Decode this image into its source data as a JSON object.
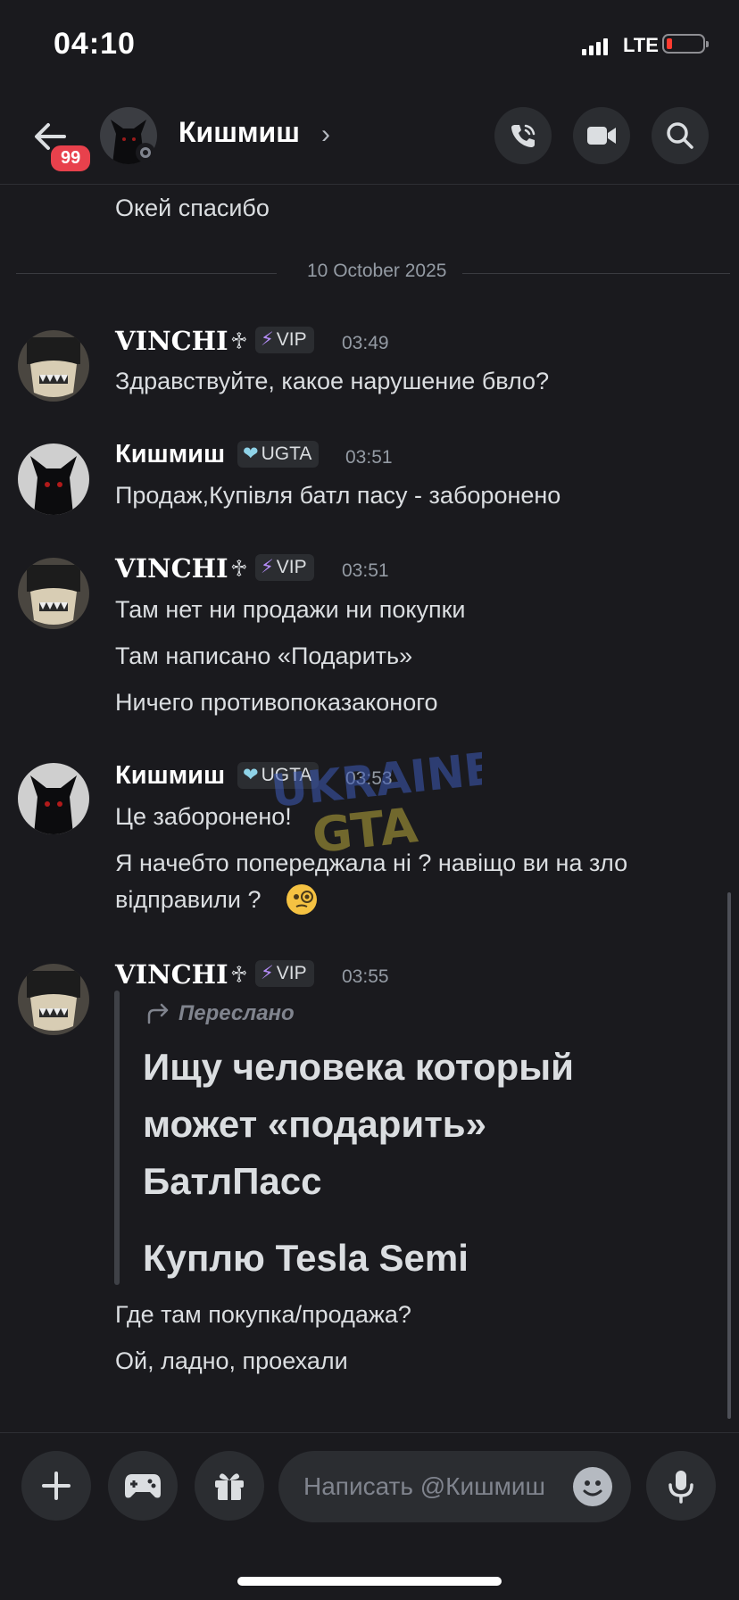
{
  "status_bar": {
    "time": "04:10",
    "network": "LTE"
  },
  "header": {
    "badge": "99",
    "contact_name": "Кишмиш"
  },
  "messages": {
    "prev_text": "Окей спасибо",
    "date_divider": "10 October 2025",
    "m1": {
      "author": "VINCHI",
      "tag": "VIP",
      "time": "03:49",
      "lines": [
        "Здравствуйте, какое нарушение бвло?"
      ]
    },
    "m2": {
      "author": "Кишмиш",
      "tag": "UGTA",
      "time": "03:51",
      "lines": [
        "Продаж,Купівля батл пасу - заборонено"
      ]
    },
    "m3": {
      "author": "VINCHI",
      "tag": "VIP",
      "time": "03:51",
      "lines": [
        "Там нет ни продажи ни покупки",
        "Там написано «Подарить»",
        "Ничего противопоказаконого"
      ]
    },
    "m4": {
      "author": "Кишмиш",
      "tag": "UGTA",
      "time": "03:53",
      "lines": [
        "Це заборонено!",
        "Я начебто попереджала ні ? навіщо ви на зло",
        "відправили ?"
      ]
    },
    "m5": {
      "author": "VINCHI",
      "tag": "VIP",
      "time": "03:55",
      "forward_label": "Переслано",
      "forward_lines": [
        "Ищу человека который",
        "может «подарить»",
        "БатлПасс",
        "Куплю Tesla Semi"
      ],
      "lines": [
        "Где там покупка/продажа?",
        "Ой, ладно, проехали"
      ]
    }
  },
  "composer": {
    "placeholder": "Написать @Кишмиш"
  },
  "icons": {
    "back": "arrow-left-icon",
    "call": "phone-icon",
    "video": "video-camera-icon",
    "search": "search-icon",
    "plus": "plus-icon",
    "game": "gamepad-icon",
    "gift": "gift-icon",
    "emoji": "smile-icon",
    "mic": "microphone-icon"
  },
  "colors": {
    "background": "#1a1a1e",
    "badge": "#e8414c",
    "vip_bolt": "#b48cf8",
    "ugta_heart": "#8fd3e8"
  }
}
